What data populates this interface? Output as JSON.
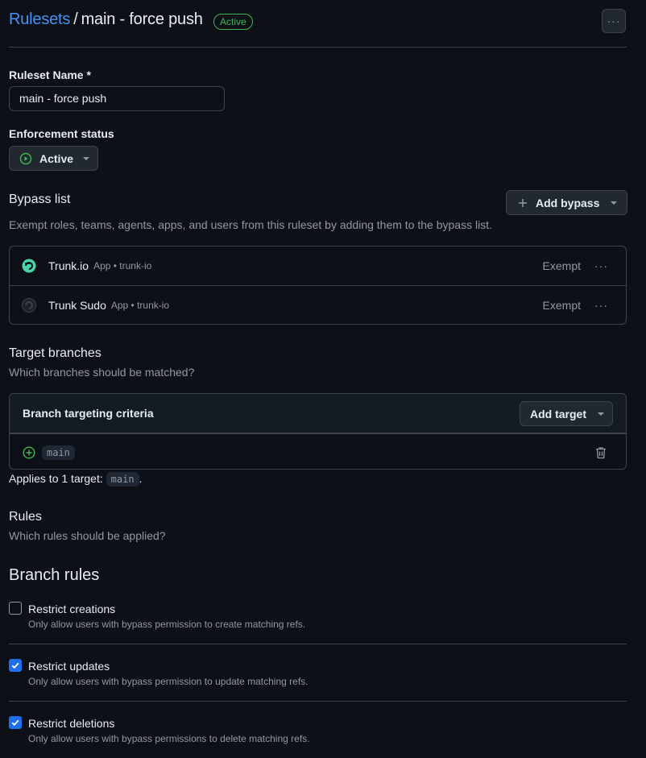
{
  "header": {
    "breadcrumb_root": "Rulesets",
    "separator": "/",
    "ruleset_title": "main - force push",
    "status_badge": "Active",
    "more_label": "···"
  },
  "name_field": {
    "label": "Ruleset Name *",
    "value": "main - force push"
  },
  "enforcement": {
    "label": "Enforcement status",
    "value": "Active"
  },
  "bypass": {
    "heading": "Bypass list",
    "add_label": "Add bypass",
    "description": "Exempt roles, teams, agents, apps, and users from this ruleset by adding them to the bypass list.",
    "items": [
      {
        "name": "Trunk.io",
        "meta": "App • trunk-io",
        "status": "Exempt",
        "more": "···"
      },
      {
        "name": "Trunk Sudo",
        "meta": "App • trunk-io",
        "status": "Exempt",
        "more": "···"
      }
    ]
  },
  "targets": {
    "heading": "Target branches",
    "description": "Which branches should be matched?",
    "criteria_title": "Branch targeting criteria",
    "add_label": "Add target",
    "branch": "main",
    "applies_prefix": "Applies to 1 target:",
    "applies_branch": "main",
    "applies_suffix": "."
  },
  "rules": {
    "heading": "Rules",
    "description": "Which rules should be applied?",
    "branch_rules_heading": "Branch rules",
    "items": [
      {
        "title": "Restrict creations",
        "desc": "Only allow users with bypass permission to create matching refs.",
        "checked": false
      },
      {
        "title": "Restrict updates",
        "desc": "Only allow users with bypass permission to update matching refs.",
        "checked": true
      },
      {
        "title": "Restrict deletions",
        "desc": "Only allow users with bypass permissions to delete matching refs.",
        "checked": true
      }
    ]
  },
  "colors": {
    "background": "#0d1117",
    "accent_link": "#4493f8",
    "active_green": "#3fb950",
    "checkbox_blue": "#1f6feb",
    "border": "#3d444d"
  }
}
